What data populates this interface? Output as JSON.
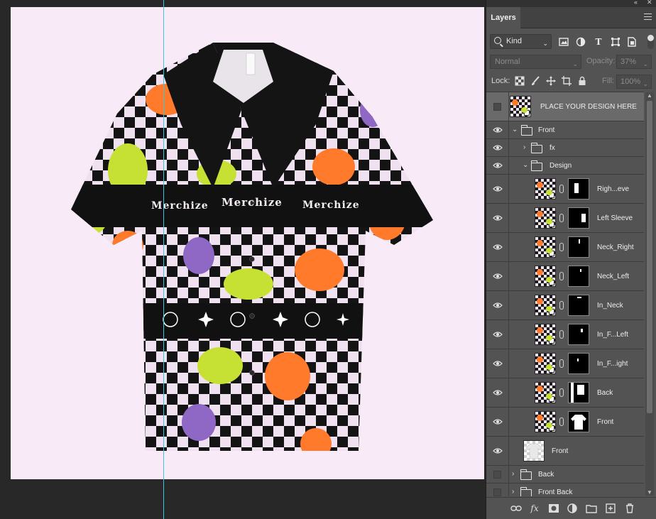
{
  "panel": {
    "tab": "Layers",
    "filter": {
      "kind_label": "Kind"
    },
    "blend_mode": "Normal",
    "opacity_label": "Opacity:",
    "opacity_value": "37%",
    "lock_label": "Lock:",
    "fill_label": "Fill:",
    "fill_value": "100%"
  },
  "canvas": {
    "wordmark": "Merchize",
    "artboard_color": "#f9eaf8",
    "guide_color": "#39c7e0"
  },
  "layers": [
    {
      "name": "PLACE YOUR DESIGN HERE",
      "kind": "smart-object",
      "visible": false,
      "selected": true
    },
    {
      "name": "Front",
      "kind": "group",
      "visible": true,
      "expanded": true
    },
    {
      "name": "fx",
      "kind": "group",
      "visible": true,
      "expanded": false
    },
    {
      "name": "Design",
      "kind": "group",
      "visible": true,
      "expanded": true
    },
    {
      "name": "Righ...eve",
      "kind": "smart-masked",
      "visible": true
    },
    {
      "name": "Left Sleeve",
      "kind": "smart-masked",
      "visible": true
    },
    {
      "name": "Neck_Right",
      "kind": "smart-masked",
      "visible": true
    },
    {
      "name": "Neck_Left",
      "kind": "smart-masked",
      "visible": true
    },
    {
      "name": "In_Neck",
      "kind": "smart-masked",
      "visible": true
    },
    {
      "name": "In_F...Left",
      "kind": "smart-masked",
      "visible": true
    },
    {
      "name": "In_F...ight",
      "kind": "smart-masked",
      "visible": true
    },
    {
      "name": "Back",
      "kind": "smart-masked",
      "visible": true
    },
    {
      "name": "Front",
      "kind": "smart-masked",
      "visible": true
    },
    {
      "name": "Front",
      "kind": "pixel",
      "visible": true
    },
    {
      "name": "Back",
      "kind": "group",
      "visible": false,
      "expanded": false
    },
    {
      "name": "Front Back",
      "kind": "group",
      "visible": false,
      "expanded": false
    }
  ],
  "icons": {
    "panel_top": [
      "collapse-icon",
      "close-icon"
    ],
    "filters": [
      "image-filter-icon",
      "adjustment-filter-icon",
      "type-filter-icon",
      "shape-filter-icon",
      "smart-filter-icon"
    ],
    "locks": [
      "lock-pixels-icon",
      "lock-image-icon",
      "lock-position-icon",
      "lock-artboard-icon",
      "lock-all-icon"
    ],
    "bottom": [
      "link-icon",
      "fx-icon",
      "mask-icon",
      "adjustment-icon",
      "group-icon",
      "new-layer-icon",
      "delete-icon"
    ]
  },
  "glyphs": {
    "collapse": "«",
    "close": "✕",
    "chev_down": "⌄",
    "twisty_open": "⌄",
    "twisty_closed": "›",
    "type_T": "T",
    "fx": "fx"
  }
}
